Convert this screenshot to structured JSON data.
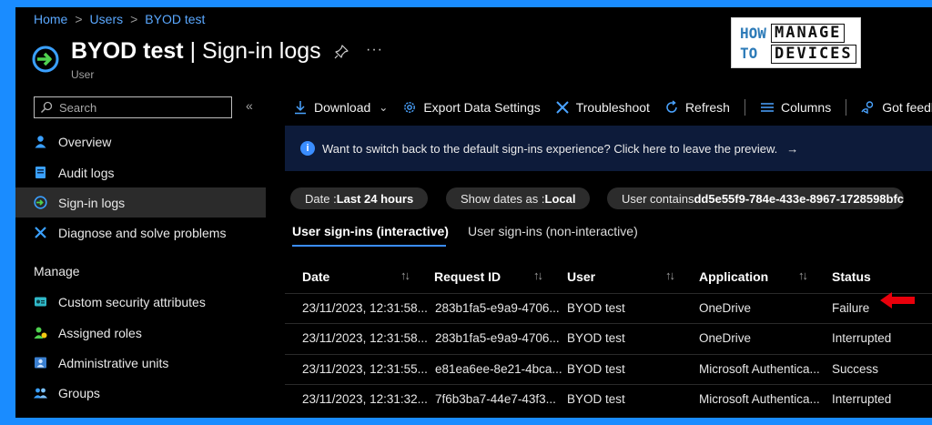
{
  "breadcrumb": {
    "home": "Home",
    "users": "Users",
    "current": "BYOD test"
  },
  "page": {
    "title_bold": "BYOD test",
    "title_rest": " | Sign-in logs",
    "subtitle": "User"
  },
  "logo": {
    "how": "HOW",
    "to": "TO",
    "manage": "MANAGE",
    "devices": "DEVICES"
  },
  "sidebar": {
    "search_placeholder": "Search",
    "collapse": "«",
    "items": [
      {
        "label": "Overview",
        "icon": "user-icon"
      },
      {
        "label": "Audit logs",
        "icon": "audit-log-icon"
      },
      {
        "label": "Sign-in logs",
        "icon": "sign-in-icon",
        "active": true
      },
      {
        "label": "Diagnose and solve problems",
        "icon": "wrench-icon"
      }
    ],
    "manage_label": "Manage",
    "manage_items": [
      {
        "label": "Custom security attributes",
        "icon": "security-attributes-icon"
      },
      {
        "label": "Assigned roles",
        "icon": "roles-icon"
      },
      {
        "label": "Administrative units",
        "icon": "admin-units-icon"
      },
      {
        "label": "Groups",
        "icon": "groups-icon"
      }
    ]
  },
  "toolbar": {
    "download": "Download",
    "export": "Export Data Settings",
    "troubleshoot": "Troubleshoot",
    "refresh": "Refresh",
    "columns": "Columns",
    "feedback": "Got feedback?"
  },
  "banner": {
    "text": "Want to switch back to the default sign-ins experience? Click here to leave the preview.",
    "arrow": "→"
  },
  "filters": {
    "date_label": "Date : ",
    "date_value": "Last 24 hours",
    "show_label": "Show dates as : ",
    "show_value": "Local",
    "user_label": "User contains ",
    "user_value": "dd5e55f9-784e-433e-8967-1728598bfc"
  },
  "tabs": {
    "interactive": "User sign-ins (interactive)",
    "noninteractive": "User sign-ins (non-interactive)"
  },
  "table": {
    "columns": [
      "Date",
      "Request ID",
      "User",
      "Application",
      "Status"
    ],
    "sort_glyph": "↑↓",
    "rows": [
      {
        "date": "23/11/2023, 12:31:58...",
        "request_id": "283b1fa5-e9a9-4706...",
        "user": "BYOD test",
        "application": "OneDrive",
        "status": "Failure"
      },
      {
        "date": "23/11/2023, 12:31:58...",
        "request_id": "283b1fa5-e9a9-4706...",
        "user": "BYOD test",
        "application": "OneDrive",
        "status": "Interrupted"
      },
      {
        "date": "23/11/2023, 12:31:55...",
        "request_id": "e81ea6ee-8e21-4bca...",
        "user": "BYOD test",
        "application": "Microsoft Authentica...",
        "status": "Success"
      },
      {
        "date": "23/11/2023, 12:31:32...",
        "request_id": "7f6b3ba7-44e7-43f3...",
        "user": "BYOD test",
        "application": "Microsoft Authentica...",
        "status": "Interrupted"
      }
    ]
  },
  "colors": {
    "accent": "#3a8dff",
    "frame": "#1a8cff",
    "annotation_arrow": "#e8000b"
  }
}
